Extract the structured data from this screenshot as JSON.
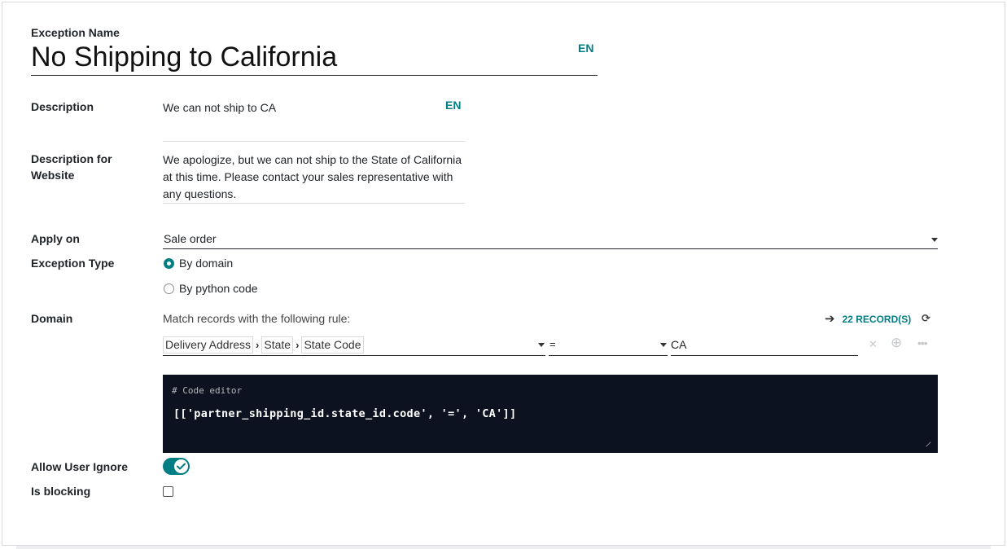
{
  "form": {
    "name_label": "Exception Name",
    "name_value": "No Shipping to California",
    "lang_code": "EN",
    "description": {
      "label": "Description",
      "value": "We can not ship to CA",
      "lang_code": "EN"
    },
    "website_description": {
      "label": "Description for Website",
      "value": "We apologize, but we can not ship to the State of California at this time.  Please contact your sales representative with any questions."
    },
    "apply_on": {
      "label": "Apply on",
      "value": "Sale order"
    },
    "exception_type": {
      "label": "Exception Type",
      "options": [
        {
          "label": "By domain",
          "selected": true
        },
        {
          "label": "By python code",
          "selected": false
        }
      ]
    },
    "domain": {
      "label": "Domain",
      "rule_text": "Match records with the following rule:",
      "records_label": "22 RECORD(S)",
      "path": [
        "Delivery Address",
        "State",
        "State Code"
      ],
      "operator": "=",
      "value": "CA",
      "code_comment": "# Code editor",
      "code": "[['partner_shipping_id.state_id.code', '=', 'CA']]"
    },
    "allow_user_ignore": {
      "label": "Allow User Ignore",
      "value": true
    },
    "is_blocking": {
      "label": "Is blocking",
      "value": false
    }
  },
  "colors": {
    "accent": "#017e84",
    "code_bg": "#0d1220",
    "text": "#212529"
  }
}
